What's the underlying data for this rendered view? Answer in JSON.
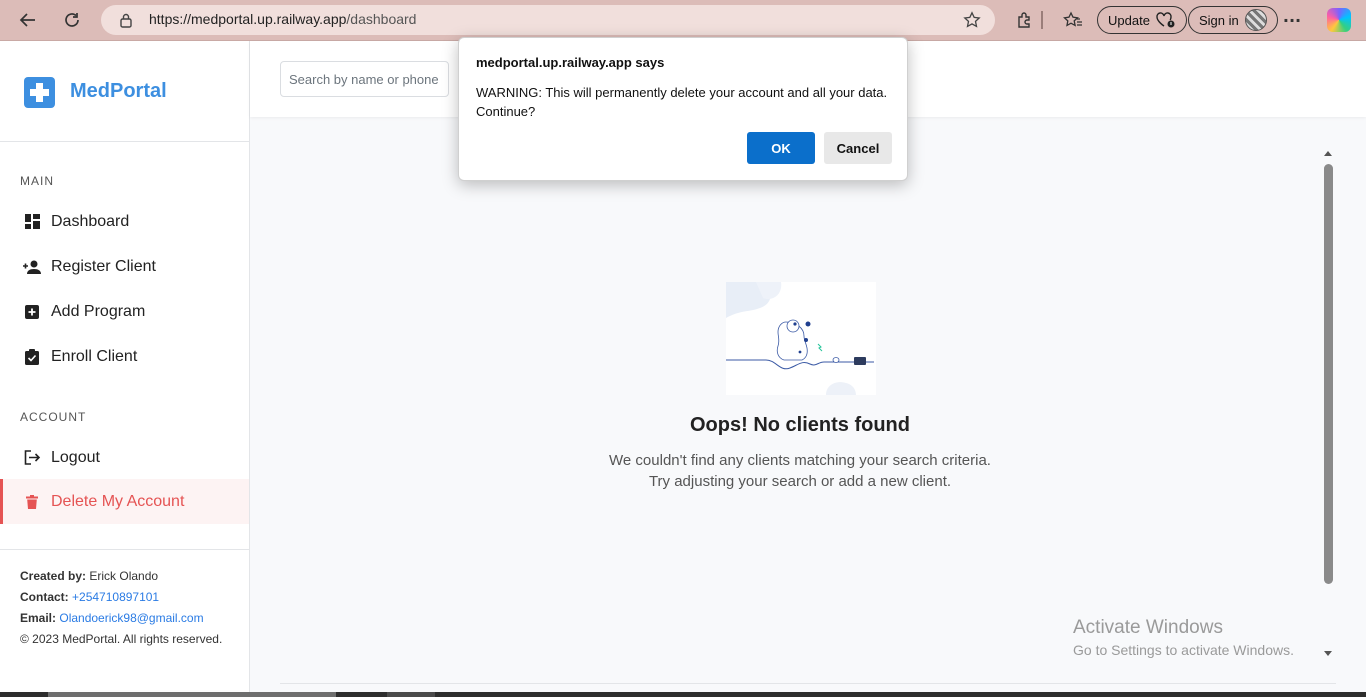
{
  "browser": {
    "url_host": "https://medportal.up.railway.app",
    "url_path": "/dashboard",
    "update_label": "Update",
    "signin_label": "Sign in",
    "more_label": "···"
  },
  "sidebar": {
    "brand": "MedPortal",
    "main_label": "MAIN",
    "main_items": [
      {
        "label": "Dashboard",
        "icon": "dashboard-icon"
      },
      {
        "label": "Register Client",
        "icon": "person-add-icon"
      },
      {
        "label": "Add Program",
        "icon": "plus-square-icon"
      },
      {
        "label": "Enroll Client",
        "icon": "clipboard-check-icon"
      }
    ],
    "account_label": "ACCOUNT",
    "account_items": [
      {
        "label": "Logout",
        "icon": "logout-icon"
      },
      {
        "label": "Delete My Account",
        "icon": "trash-icon"
      }
    ],
    "footer": {
      "created_by_label": "Created by:",
      "created_by": "Erick Olando",
      "contact_label": "Contact:",
      "contact": "+254710897101",
      "email_label": "Email:",
      "email": "Olandoerick98@gmail.com",
      "copyright": "© 2023 MedPortal. All rights reserved."
    }
  },
  "search": {
    "placeholder": "Search by name or phone"
  },
  "empty_state": {
    "title": "Oops! No clients found",
    "message": "We couldn't find any clients matching your search criteria. Try adjusting your search or add a new client."
  },
  "dialog": {
    "title": "medportal.up.railway.app says",
    "message": "WARNING: This will permanently delete your account and all your data. Continue?",
    "ok_label": "OK",
    "cancel_label": "Cancel"
  },
  "watermark": {
    "line1": "Activate Windows",
    "line2": "Go to Settings to activate Windows."
  },
  "colors": {
    "accent": "#3d8fe0",
    "danger": "#e55353",
    "ok_button": "#0b6fcb",
    "browser_chrome": "#dcbcb8"
  }
}
